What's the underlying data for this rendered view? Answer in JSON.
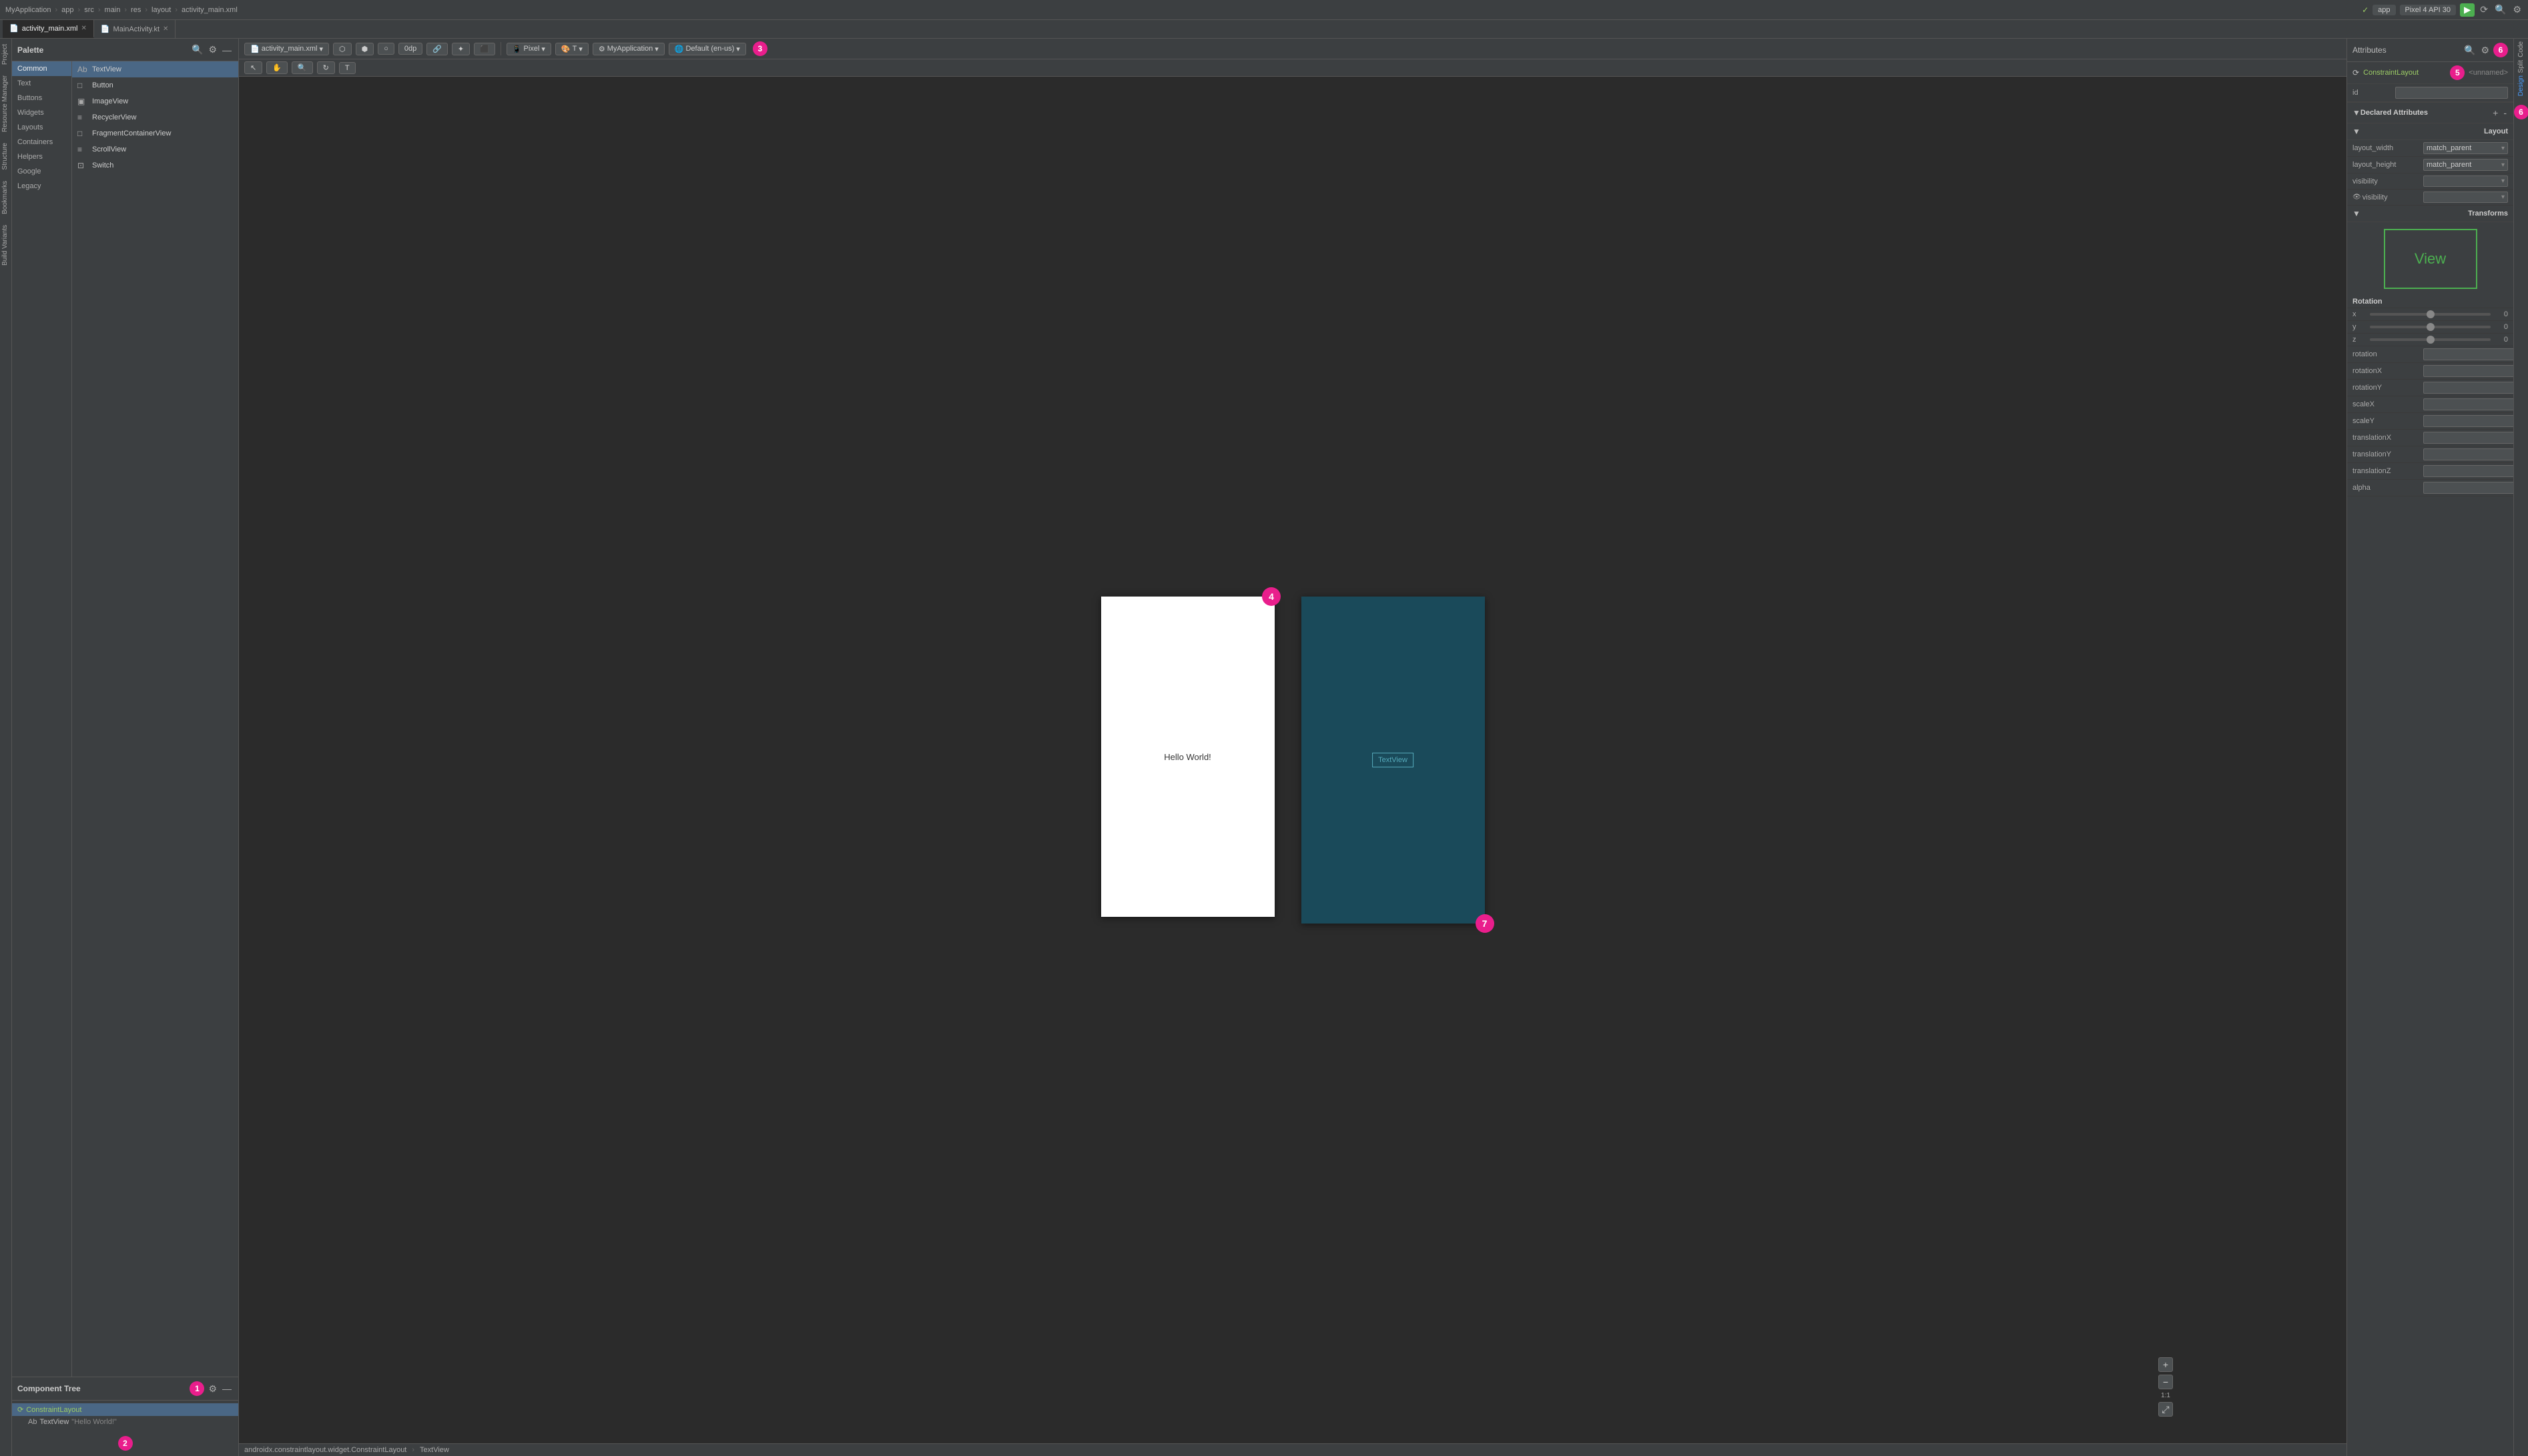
{
  "app": {
    "title": "MyApplication"
  },
  "titlebar": {
    "breadcrumbs": [
      "MyApplication",
      "app",
      "src",
      "main",
      "res",
      "layout",
      "activity_main.xml"
    ],
    "device_btn": "app",
    "api_btn": "Pixel 4 API 30"
  },
  "tabs": [
    {
      "label": "activity_main.xml",
      "active": true
    },
    {
      "label": "MainActivity.kt",
      "active": false
    }
  ],
  "palette": {
    "title": "Palette",
    "categories": [
      {
        "label": "Common",
        "active": true
      },
      {
        "label": "Text",
        "active": false
      },
      {
        "label": "Buttons",
        "active": false
      },
      {
        "label": "Widgets",
        "active": false
      },
      {
        "label": "Layouts",
        "active": false
      },
      {
        "label": "Containers",
        "active": false
      },
      {
        "label": "Helpers",
        "active": false
      },
      {
        "label": "Google",
        "active": false
      },
      {
        "label": "Legacy",
        "active": false
      }
    ],
    "items": [
      {
        "label": "TextView",
        "icon": "Ab"
      },
      {
        "label": "Button",
        "icon": "□"
      },
      {
        "label": "ImageView",
        "icon": "▣"
      },
      {
        "label": "RecyclerView",
        "icon": "≡"
      },
      {
        "label": "FragmentContainerView",
        "icon": "□"
      },
      {
        "label": "ScrollView",
        "icon": "≡"
      },
      {
        "label": "Switch",
        "icon": "⊡"
      }
    ]
  },
  "component_tree": {
    "title": "Component Tree",
    "items": [
      {
        "label": "ConstraintLayout",
        "icon": "⟳",
        "level": 0,
        "selected": true
      },
      {
        "label": "Ab TextView",
        "value": "\"Hello World!\"",
        "level": 1,
        "selected": false
      }
    ]
  },
  "canvas": {
    "design_label": "Hello World!",
    "blueprint_label": "TextView",
    "toolbar": {
      "file_name": "activity_main.xml",
      "padding": "0dp",
      "pixel_label": "Pixel",
      "t_label": "T",
      "app_label": "MyApplication",
      "locale_label": "Default (en-us)"
    }
  },
  "attributes": {
    "title": "Attributes",
    "component": "ConstraintLayout",
    "id_label": "id",
    "id_placeholder": "",
    "sections": {
      "declared": {
        "label": "Declared Attributes",
        "add": "+",
        "remove": "-"
      },
      "layout": {
        "label": "Layout",
        "rows": [
          {
            "label": "layout_width",
            "value": "match_parent",
            "dropdown": true
          },
          {
            "label": "layout_height",
            "value": "match_parent",
            "dropdown": true
          },
          {
            "label": "visibility",
            "value": "",
            "dropdown": true
          },
          {
            "label": "visibility",
            "value": "",
            "dropdown": true,
            "icon": true
          }
        ]
      },
      "transforms": {
        "label": "Transforms",
        "view_text": "View",
        "rotation": {
          "label": "Rotation",
          "axes": [
            {
              "axis": "x",
              "value": "0"
            },
            {
              "axis": "y",
              "value": "0"
            },
            {
              "axis": "z",
              "value": "0"
            }
          ]
        },
        "fields": [
          {
            "label": "rotation",
            "value": ""
          },
          {
            "label": "rotationX",
            "value": ""
          },
          {
            "label": "rotationY",
            "value": ""
          },
          {
            "label": "scaleX",
            "value": ""
          },
          {
            "label": "scaleY",
            "value": ""
          },
          {
            "label": "translationX",
            "value": ""
          },
          {
            "label": "translationY",
            "value": ""
          },
          {
            "label": "translationZ",
            "value": ""
          },
          {
            "label": "alpha",
            "value": ""
          }
        ]
      }
    }
  },
  "status_bar": {
    "class": "androidx.constraintlayout.widget.ConstraintLayout",
    "component": "TextView"
  },
  "badges": {
    "b1": "1",
    "b2": "2",
    "b3": "3",
    "b4": "4",
    "b5": "5",
    "b6": "6",
    "b7": "7"
  },
  "sidebar_left": {
    "tabs": [
      "Project",
      "Resource Manager",
      "Structure",
      "Bookmarks",
      "Build Variants"
    ]
  },
  "sidebar_right": {
    "tabs": [
      "Code",
      "Split",
      "Design"
    ]
  },
  "zoom": {
    "ratio": "1:1"
  }
}
